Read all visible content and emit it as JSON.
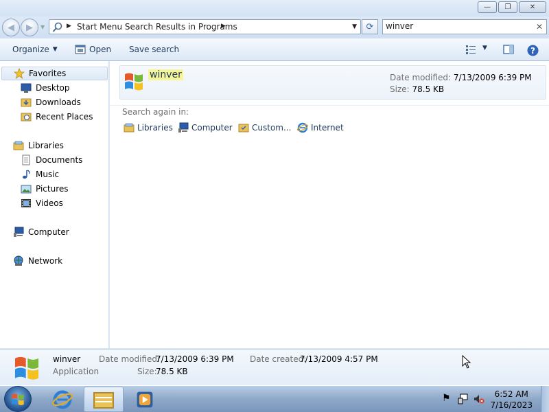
{
  "window": {
    "minimize_glyph": "—",
    "restore_glyph": "❐",
    "close_glyph": "✕"
  },
  "address": {
    "path": "Start Menu Search Results in Programs",
    "back_glyph": "◀",
    "forward_glyph": "▶"
  },
  "search": {
    "value": "winver"
  },
  "toolbar": {
    "organize": "Organize",
    "open": "Open",
    "save_search": "Save search"
  },
  "nav": {
    "favorites": "Favorites",
    "desktop": "Desktop",
    "downloads": "Downloads",
    "recent_places": "Recent Places",
    "libraries": "Libraries",
    "documents": "Documents",
    "music": "Music",
    "pictures": "Pictures",
    "videos": "Videos",
    "computer": "Computer",
    "network": "Network"
  },
  "result": {
    "name": "winver",
    "date_modified_label": "Date modified:",
    "date_modified": "7/13/2009 6:39 PM",
    "size_label": "Size:",
    "size": "78.5 KB"
  },
  "search_again": {
    "label": "Search again in:",
    "locations": [
      "Libraries",
      "Computer",
      "Custom...",
      "Internet"
    ]
  },
  "details": {
    "name": "winver",
    "type": "Application",
    "date_modified_label": "Date modified:",
    "date_modified": "7/13/2009 6:39 PM",
    "size_label": "Size:",
    "size": "78.5 KB",
    "date_created_label": "Date created:",
    "date_created": "7/13/2009 4:57 PM"
  },
  "taskbar": {
    "time": "6:52 AM",
    "date": "7/16/2023"
  },
  "colors": {
    "accent": "#1e395b",
    "highlight": "#f6f59a"
  }
}
